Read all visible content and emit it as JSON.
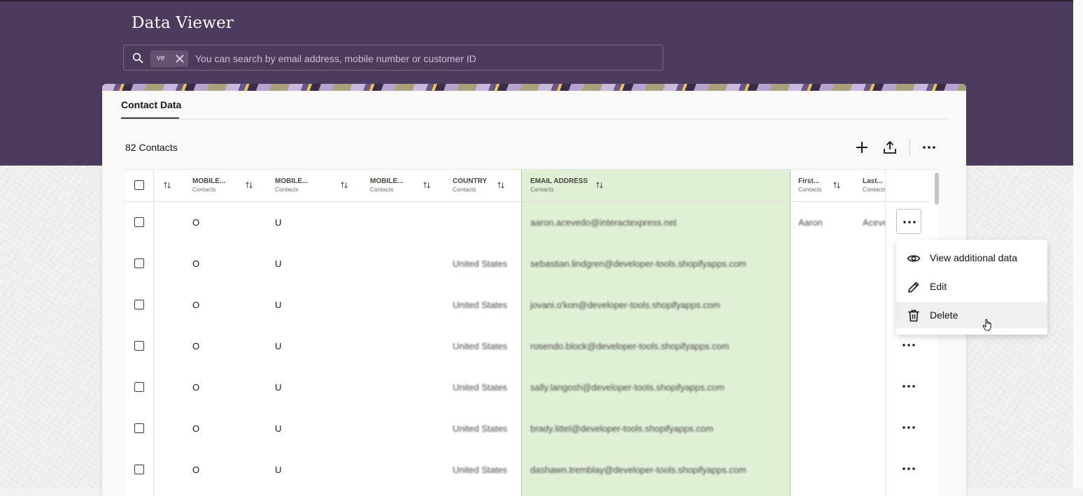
{
  "app": {
    "title": "Data Viewer"
  },
  "search": {
    "chip": "ve",
    "placeholder": "You can search by email address, mobile number or customer ID",
    "value": ""
  },
  "tabs": [
    {
      "label": "Contact Data",
      "active": true
    }
  ],
  "toolbar": {
    "count_label": "82 Contacts",
    "add_icon": "plus-icon",
    "export_icon": "upload-icon",
    "more_icon": "ellipsis-icon"
  },
  "table": {
    "columns": [
      {
        "title": "MOBILE...",
        "subtitle": "Contacts"
      },
      {
        "title": "MOBILE...",
        "subtitle": "Contacts"
      },
      {
        "title": "MOBILE...",
        "subtitle": "Contacts"
      },
      {
        "title": "COUNTRY",
        "subtitle": "Contacts"
      },
      {
        "title": "EMAIL ADDRESS",
        "subtitle": "Contacts"
      },
      {
        "title": "First...",
        "subtitle": "Contacts"
      },
      {
        "title": "Last...",
        "subtitle": "Contacts"
      }
    ],
    "rows": [
      {
        "m1": "O",
        "m2": "U",
        "m3": "",
        "country": "",
        "email": "aaron.acevedo@interactexpress.net",
        "first": "Aaron",
        "last": "Aceve"
      },
      {
        "m1": "O",
        "m2": "U",
        "m3": "",
        "country": "United States",
        "email": "sebastian.lindgren@developer-tools.shopifyapps.com",
        "first": "",
        "last": ""
      },
      {
        "m1": "O",
        "m2": "U",
        "m3": "",
        "country": "United States",
        "email": "jovani.o'kon@developer-tools.shopifyapps.com",
        "first": "",
        "last": ""
      },
      {
        "m1": "O",
        "m2": "U",
        "m3": "",
        "country": "United States",
        "email": "rosendo.block@developer-tools.shopifyapps.com",
        "first": "",
        "last": ""
      },
      {
        "m1": "O",
        "m2": "U",
        "m3": "",
        "country": "United States",
        "email": "sally.langosh@developer-tools.shopifyapps.com",
        "first": "",
        "last": ""
      },
      {
        "m1": "O",
        "m2": "U",
        "m3": "",
        "country": "United States",
        "email": "brady.littel@developer-tools.shopifyapps.com",
        "first": "",
        "last": ""
      },
      {
        "m1": "O",
        "m2": "U",
        "m3": "",
        "country": "United States",
        "email": "dashawn.tremblay@developer-tools.shopifyapps.com",
        "first": "",
        "last": ""
      }
    ]
  },
  "context_menu": {
    "items": [
      {
        "label": "View additional data",
        "icon": "eye-icon"
      },
      {
        "label": "Edit",
        "icon": "pencil-icon"
      },
      {
        "label": "Delete",
        "icon": "trash-icon",
        "hovered": true
      }
    ]
  },
  "colors": {
    "header_band": "#4e3a5d",
    "email_column_highlight": "#dff0d6",
    "card": "#fbf9f8"
  }
}
